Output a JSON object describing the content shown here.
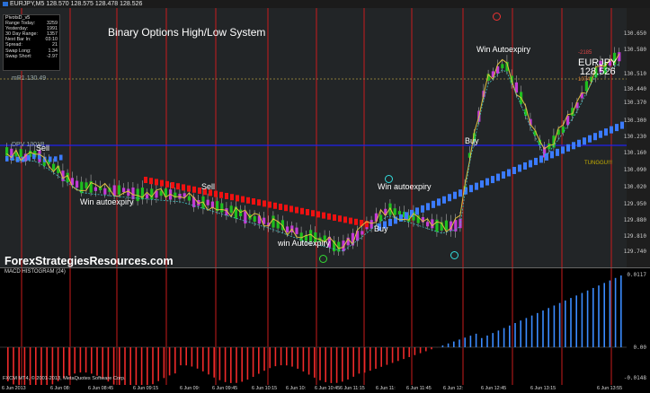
{
  "title_bar": "EURJPY,M5  128.570 128.575 128.478 128.526",
  "chart_title": "Binary Options High/Low System",
  "brand": "ForexStrategiesResources.com",
  "info_box": {
    "title": "PivotsD_v5",
    "rows": [
      {
        "label": "Range Today:",
        "value": "3259"
      },
      {
        "label": "Yesterday:",
        "value": "1991"
      },
      {
        "label": "30 Day Range:",
        "value": "1357"
      },
      {
        "label": "Next Bar In:",
        "value": "03:10"
      },
      {
        "label": "Spread:",
        "value": "21"
      },
      {
        "label": "Swap Long:",
        "value": "1.34"
      },
      {
        "label": "Swap Short:",
        "value": "-2.97"
      }
    ]
  },
  "lines": {
    "mr1": "mR1  130.49",
    "dpv": "DPV  1301B"
  },
  "annotations": {
    "sell_1": "Sell",
    "sell_2": "Sell",
    "win_1": "Win autoexpiry",
    "win_2": "win Autoexpiry",
    "win_3": "Win autoexpiry",
    "win_4": "Win Autoexpiry",
    "buy_1": "Buy",
    "buy_2": "Buy"
  },
  "current_price": {
    "symbol": "EURJPY",
    "price": "128.526"
  },
  "right_panel": {
    "top_value": "-2185",
    "sub_value": "1074",
    "tunggu": "TUNGGU!!!"
  },
  "price_axis": [
    "130.650",
    "130.580",
    "130.510",
    "130.440",
    "130.370",
    "130.300",
    "130.230",
    "130.160",
    "130.090",
    "130.020",
    "129.950",
    "129.880",
    "129.810",
    "129.740"
  ],
  "macd": {
    "title": "MACD HISTOGRAM (24)",
    "axis_top": "0.0117",
    "axis_zero": "0.00",
    "axis_bottom": "-0.0148"
  },
  "copyright": "FXCM MT4, © 2001-2013, MetaQuotes Software Corp.",
  "time_axis": [
    "6 Jun 2013",
    "6 Jun 08:",
    "6 Jun 08:45",
    "6 Jun 09:15",
    "6 Jun 09:",
    "6 Jun 09:45",
    "6 Jun 10:15",
    "6 Jun 10:",
    "6 Jun 10:45",
    "6 Jun 11:15",
    "6 Jun 11:",
    "6 Jun 11:45",
    "6 Jun 12:",
    "6 Jun 12:45",
    "6 Jun 13:15",
    "6 Jun 13:55"
  ],
  "colors": {
    "bull": "#1fbf1f",
    "bear": "#c43bd6",
    "bear_signal": "#ee1111",
    "bull_signal": "#3b7bff",
    "macd_pos": "#3b8bff",
    "macd_neg": "#ee2a2a",
    "session_line": "#c81c1c",
    "dpv_line": "#2020ee"
  }
}
